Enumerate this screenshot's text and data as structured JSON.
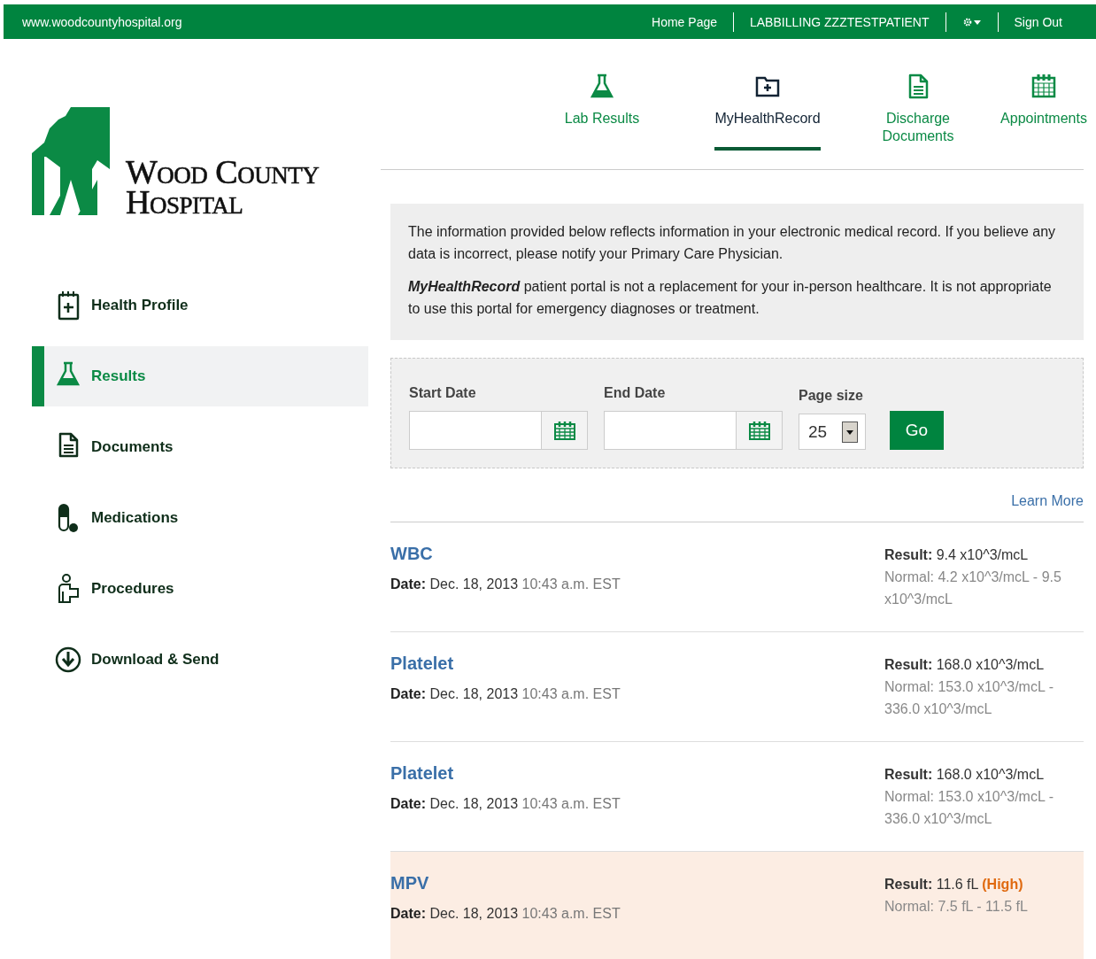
{
  "top_bar": {
    "site": "www.woodcountyhospital.org",
    "links": [
      {
        "kind": "text",
        "label": "Home Page"
      },
      {
        "kind": "text",
        "label": "LABBILLING ZZZTESTPATIENT"
      },
      {
        "kind": "gear"
      },
      {
        "kind": "text",
        "label": "Sign Out"
      }
    ]
  },
  "logo": {
    "line_1": "Wood County",
    "line_2": "Hospital"
  },
  "tabs": [
    {
      "kind": "flask",
      "label": "Lab Results",
      "selected": false
    },
    {
      "kind": "folder",
      "label": "MyHealthRecord",
      "selected": true
    },
    {
      "kind": "document",
      "label": "Discharge Documents",
      "selected": false
    },
    {
      "kind": "calendar",
      "label": "Appointments",
      "selected": false
    }
  ],
  "sidebar": {
    "items": [
      {
        "kind": "profile",
        "label": "Health Profile",
        "selected": false
      },
      {
        "kind": "flask",
        "label": "Results",
        "selected": true
      },
      {
        "kind": "document",
        "label": "Documents",
        "selected": false
      },
      {
        "kind": "pill",
        "label": "Medications",
        "selected": false
      },
      {
        "kind": "person",
        "label": "Procedures",
        "selected": false
      },
      {
        "kind": "download",
        "label": "Download & Send",
        "selected": false
      }
    ]
  },
  "notice": [
    "The information provided below reflects information in your electronic medical record. If you believe any data is incorrect, please notify your Primary Care Physician.",
    "**MyHealthRecord** patient portal is not a replacement for your in-person healthcare. It is not appropriate to use this portal for emergency diagnoses or treatment."
  ],
  "filters": {
    "start_date": {
      "label": "Start Date"
    },
    "end_date": {
      "label": "End Date"
    },
    "page_size": {
      "label": "Page size",
      "value": "25"
    },
    "go_button": "Go"
  },
  "learn_more": "Learn More",
  "results": [
    {
      "name": "WBC",
      "date_label": "Date:",
      "date": "Dec. 18, 2013",
      "time": "10:43 a.m. EST",
      "result_label": "Result:",
      "value": "9.4 x10^3/mcL",
      "normal": "Normal: 4.2 x10^3/mcL - 9.5 x10^3/mcL",
      "abnormal": false
    },
    {
      "name": "Platelet",
      "date_label": "Date:",
      "date": "Dec. 18, 2013",
      "time": "10:43 a.m. EST",
      "result_label": "Result:",
      "value": "168.0 x10^3/mcL",
      "normal": "Normal: 153.0 x10^3/mcL - 336.0 x10^3/mcL",
      "abnormal": false
    },
    {
      "name": "Platelet",
      "date_label": "Date:",
      "date": "Dec. 18, 2013",
      "time": "10:43 a.m. EST",
      "result_label": "Result:",
      "value": "168.0 x10^3/mcL",
      "normal": "Normal: 153.0 x10^3/mcL - 336.0 x10^3/mcL",
      "abnormal": false
    },
    {
      "name": "MPV",
      "date_label": "Date:",
      "date": "Dec. 18, 2013",
      "time": "10:43 a.m. EST",
      "result_label": "Result:",
      "value": "11.6 fL",
      "flag": "(High)",
      "normal": "Normal: 7.5 fL - 11.5 fL",
      "abnormal": true
    }
  ]
}
